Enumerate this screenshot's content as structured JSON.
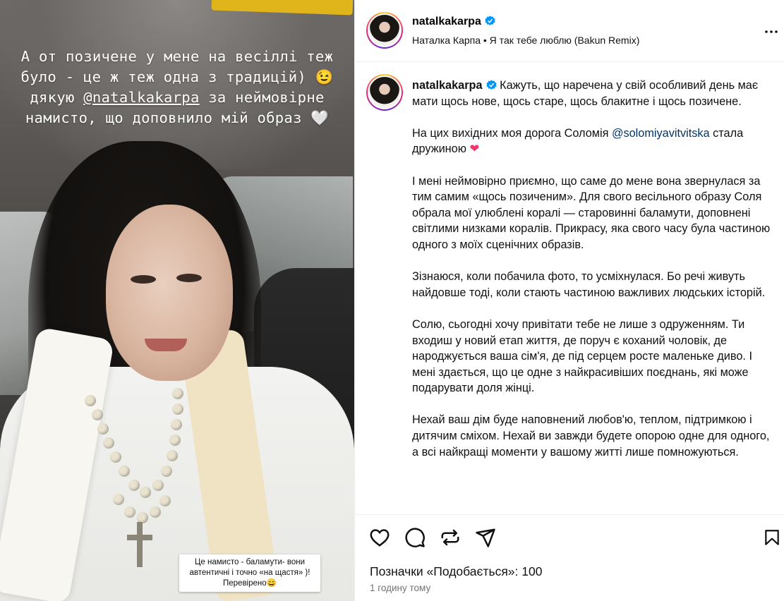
{
  "story": {
    "line1": "А от позичене у мене на весіллі теж",
    "line2": "було - це ж теж одна з традицій) 😉",
    "line3_pre": "дякую ",
    "line3_mention": "@natalkakarpa",
    "line3_post": " за неймовірне",
    "line4": "намисто, що доповнило мій образ 🤍",
    "sticker": "Це намисто - баламути- вони автентичні і точно «на щастя» )! Перевірено😄"
  },
  "header": {
    "username": "natalkakarpa",
    "audio": "Наталка Карпа • Я так тебе люблю (Bakun Remix)"
  },
  "caption": {
    "username": "natalkakarpa",
    "p1": "Кажуть, що наречена у свій особливий день має мати щось нове, щось старе, щось блакитне і щось позичене.",
    "p2_pre": "На цих вихідних моя дорога Соломія ",
    "p2_mention": "@solomiyavitvitska",
    "p2_post": " стала дружиною ",
    "p2_emoji": "❤",
    "p3": "І мені неймовірно приємно, що саме до мене вона звернулася за тим самим «щось позиченим». Для свого весільного образу Соля обрала мої улюблені коралі — старовинні баламути, доповнені світлими низками коралів. Прикрасу, яка свого часу була частиною одного з моїх сценічних образів.",
    "p4": "Зізнаюся, коли побачила фото, то усміхнулася. Бо речі живуть найдовше тоді, коли стають частиною важливих людських історій.",
    "p5": "Солю, сьогодні хочу привітати тебе не лише з одруженням. Ти входиш у новий етап життя, де поруч є коханий чоловік, де народжується ваша сім'я, де під серцем росте маленьке диво. І мені здається, що це одне з найкрасивіших поєднань, які може подарувати доля жінці.",
    "p6": "Нехай ваш дім буде наповнений любов'ю, теплом, підтримкою і дитячим сміхом. Нехай ви завжди будете опорою одне для одного, а всі найкращі моменти у вашому житті лише помножуються."
  },
  "footer": {
    "likes": "Позначки «Подобається»: 100",
    "time": "1 годину тому"
  },
  "icons": [
    "heart-icon",
    "comment-icon",
    "share-icon",
    "send-icon",
    "save-icon",
    "more-icon",
    "verified-icon"
  ],
  "colors": {
    "verified": "#0095f6",
    "mention": "#00376b",
    "muted": "#737373"
  }
}
